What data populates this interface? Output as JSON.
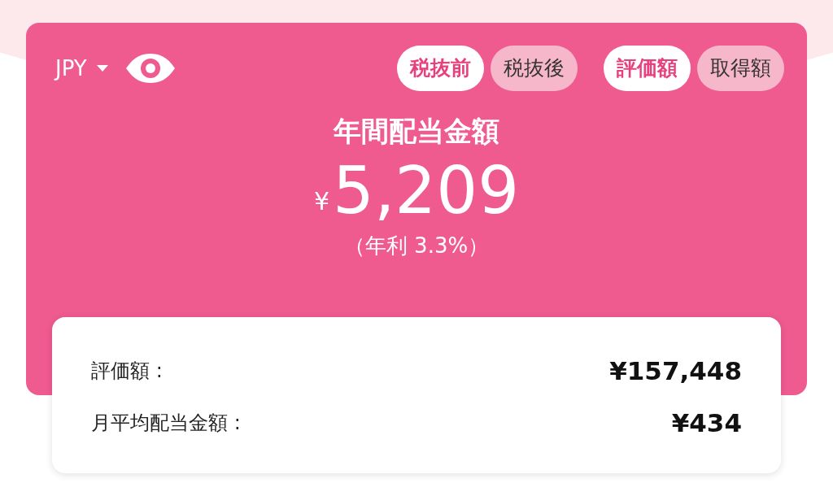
{
  "currency": {
    "label": "JPY"
  },
  "toggle_groups": [
    [
      {
        "label": "税抜前",
        "selected": true
      },
      {
        "label": "税抜後",
        "selected": false
      }
    ],
    [
      {
        "label": "評価額",
        "selected": true
      },
      {
        "label": "取得額",
        "selected": false
      }
    ]
  ],
  "title": "年間配当金額",
  "amount": {
    "symbol": "¥",
    "value": "5,209"
  },
  "yield": "（年利 3.3%）",
  "summary": [
    {
      "label": "評価額 :",
      "value": "¥157,448"
    },
    {
      "label": "月平均配当金額 :",
      "value": "¥434"
    }
  ]
}
